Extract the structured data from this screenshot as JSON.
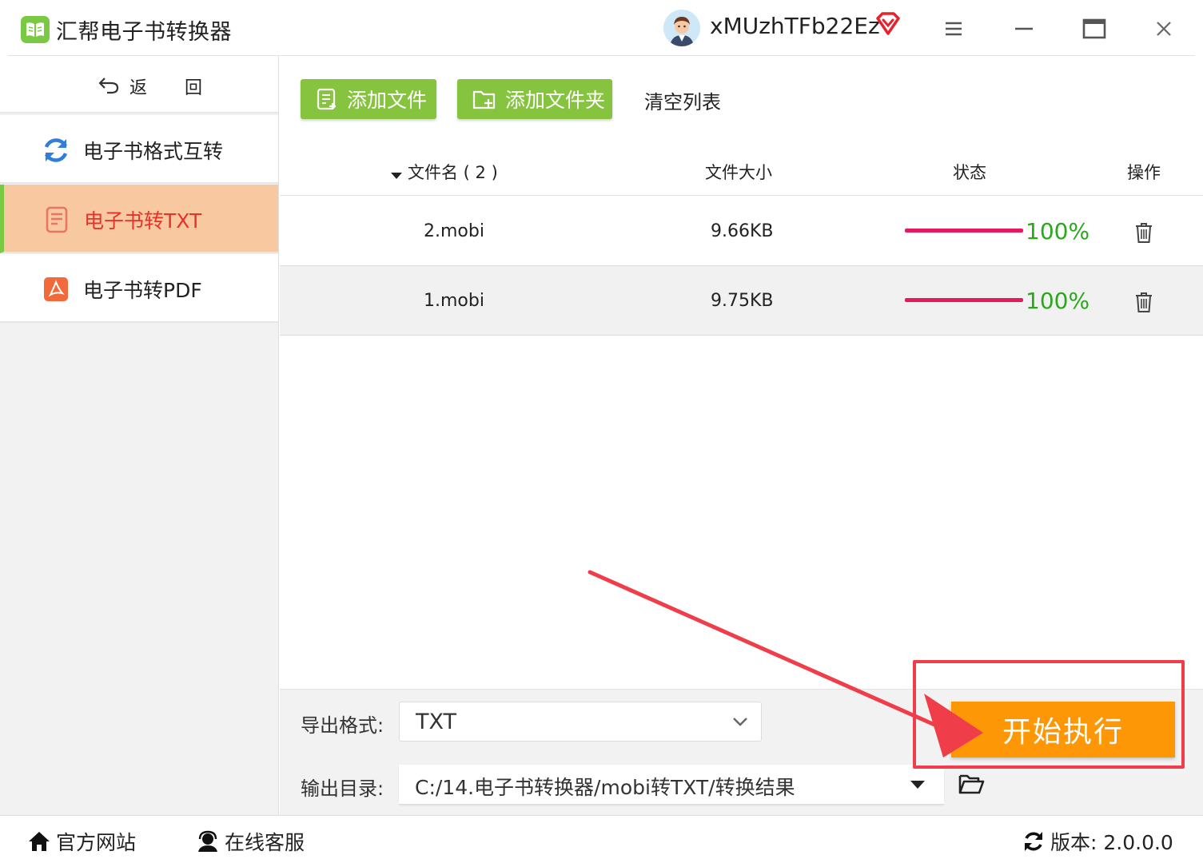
{
  "app": {
    "title": "汇帮电子书转换器",
    "username": "xMUzhTFb22Ez",
    "colors": {
      "accent_green": "#86c43f",
      "active_bg": "#f8c9a0",
      "active_text": "#e8312a",
      "progress": "#e5195e",
      "done_text": "#2aa81a",
      "start_button": "#fd9705",
      "highlight": "#ef3e4a"
    }
  },
  "titlebar": {
    "icons": [
      "app-logo-icon",
      "avatar-icon",
      "vip-diamond-icon",
      "menu-icon",
      "minimize-icon",
      "maximize-icon",
      "close-icon"
    ]
  },
  "sidebar": {
    "back_label": "返 回",
    "items": [
      {
        "label": "电子书格式互转",
        "icon": "convert-sync-icon",
        "active": false
      },
      {
        "label": "电子书转TXT",
        "icon": "txt-document-icon",
        "active": true
      },
      {
        "label": "电子书转PDF",
        "icon": "pdf-icon",
        "active": false
      }
    ]
  },
  "toolbar": {
    "add_file": "添加文件",
    "add_folder": "添加文件夹",
    "clear_list": "清空列表"
  },
  "table": {
    "headers": {
      "name": "文件名 ( 2 )",
      "size": "文件大小",
      "status": "状态",
      "action": "操作"
    },
    "rows": [
      {
        "name": "2.mobi",
        "size": "9.66KB",
        "progress": 1.0,
        "status": "100%"
      },
      {
        "name": "1.mobi",
        "size": "9.75KB",
        "progress": 1.0,
        "status": "100%"
      }
    ]
  },
  "settings": {
    "format_label": "导出格式:",
    "format_value": "TXT",
    "dir_label": "输出目录:",
    "dir_value": "C:/14.电子书转换器/mobi转TXT/转换结果",
    "start_button": "开始执行"
  },
  "footer": {
    "website": "官方网站",
    "support": "在线客服",
    "version": "版本: 2.0.0.0"
  }
}
